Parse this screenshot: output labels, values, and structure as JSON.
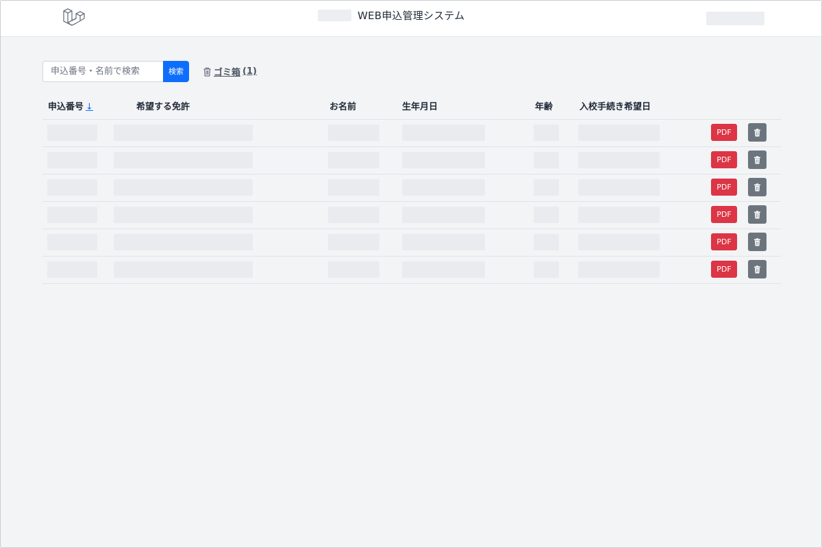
{
  "header": {
    "app_title": "WEB申込管理システム",
    "logo_icon": "laravel-logo-icon"
  },
  "search": {
    "placeholder": "申込番号・名前で検索",
    "value": "",
    "button_label": "検索"
  },
  "trash": {
    "icon": "trash-icon",
    "label": "ゴミ箱",
    "count": "(1)"
  },
  "table": {
    "columns": [
      {
        "label": "申込番号",
        "sort_indicator": "↓"
      },
      {
        "label": "希望する免許"
      },
      {
        "label": "お名前"
      },
      {
        "label": "生年月日"
      },
      {
        "label": "年齢"
      },
      {
        "label": "入校手続き希望日"
      }
    ],
    "rows": [
      {
        "pdf_label": "PDF",
        "delete_icon": "trash-icon"
      },
      {
        "pdf_label": "PDF",
        "delete_icon": "trash-icon"
      },
      {
        "pdf_label": "PDF",
        "delete_icon": "trash-icon"
      },
      {
        "pdf_label": "PDF",
        "delete_icon": "trash-icon"
      },
      {
        "pdf_label": "PDF",
        "delete_icon": "trash-icon"
      },
      {
        "pdf_label": "PDF",
        "delete_icon": "trash-icon"
      }
    ]
  },
  "colors": {
    "page_bg": "#f3f4f6",
    "primary": "#0d6efd",
    "danger": "#dc3545",
    "secondary": "#6c757d"
  }
}
